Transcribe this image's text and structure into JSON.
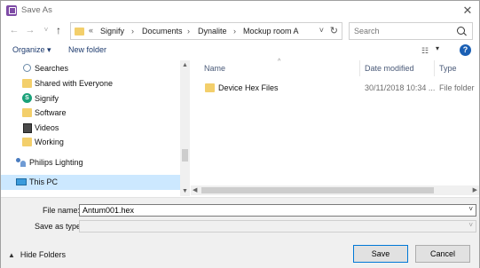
{
  "window": {
    "title": "Save As",
    "close_glyph": "✕"
  },
  "navigation": {
    "back_glyph": "←",
    "forward_glyph": "→",
    "dropdown_glyph": "˅",
    "up_glyph": "↑",
    "breadcrumb_overflow": "«",
    "breadcrumbs": [
      "Signify",
      "Documents",
      "Dynalite",
      "Mockup room A"
    ],
    "separator": "›",
    "refresh_glyph": "↻",
    "search_placeholder": "Search"
  },
  "toolbar": {
    "organize_label": "Organize ▾",
    "new_folder_label": "New folder",
    "view_glyph": "☷",
    "view_dropdown_glyph": "▾",
    "help_glyph": "?"
  },
  "nav_pane": {
    "items": [
      {
        "label": "Searches",
        "icon": "search-icon"
      },
      {
        "label": "Shared with Everyone",
        "icon": "folder-icon"
      },
      {
        "label": "Signify",
        "icon": "signify-icon"
      },
      {
        "label": "Software",
        "icon": "folder-icon"
      },
      {
        "label": "Videos",
        "icon": "video-icon"
      },
      {
        "label": "Working",
        "icon": "folder-icon"
      },
      {
        "label": "Philips Lighting",
        "icon": "people-icon"
      },
      {
        "label": "This PC",
        "icon": "pc-icon",
        "selected": true
      }
    ]
  },
  "file_list": {
    "columns": [
      "Name",
      "Date modified",
      "Type"
    ],
    "rows": [
      {
        "name": "Device Hex Files",
        "date": "30/11/2018 10:34 ...",
        "type": "File folder"
      }
    ]
  },
  "form": {
    "file_name_label": "File name:",
    "file_name_value": "Antum001.hex",
    "save_as_type_label": "Save as type:",
    "save_as_type_value": "",
    "dropdown_glyph": "˅"
  },
  "footer": {
    "hide_folders_caret": "▲",
    "hide_folders_label": "Hide Folders",
    "save_label": "Save",
    "cancel_label": "Cancel"
  },
  "colors": {
    "accent": "#0078d7",
    "selection": "#cce8ff",
    "app_icon": "#7e4ba6",
    "folder": "#f3cf6b"
  }
}
